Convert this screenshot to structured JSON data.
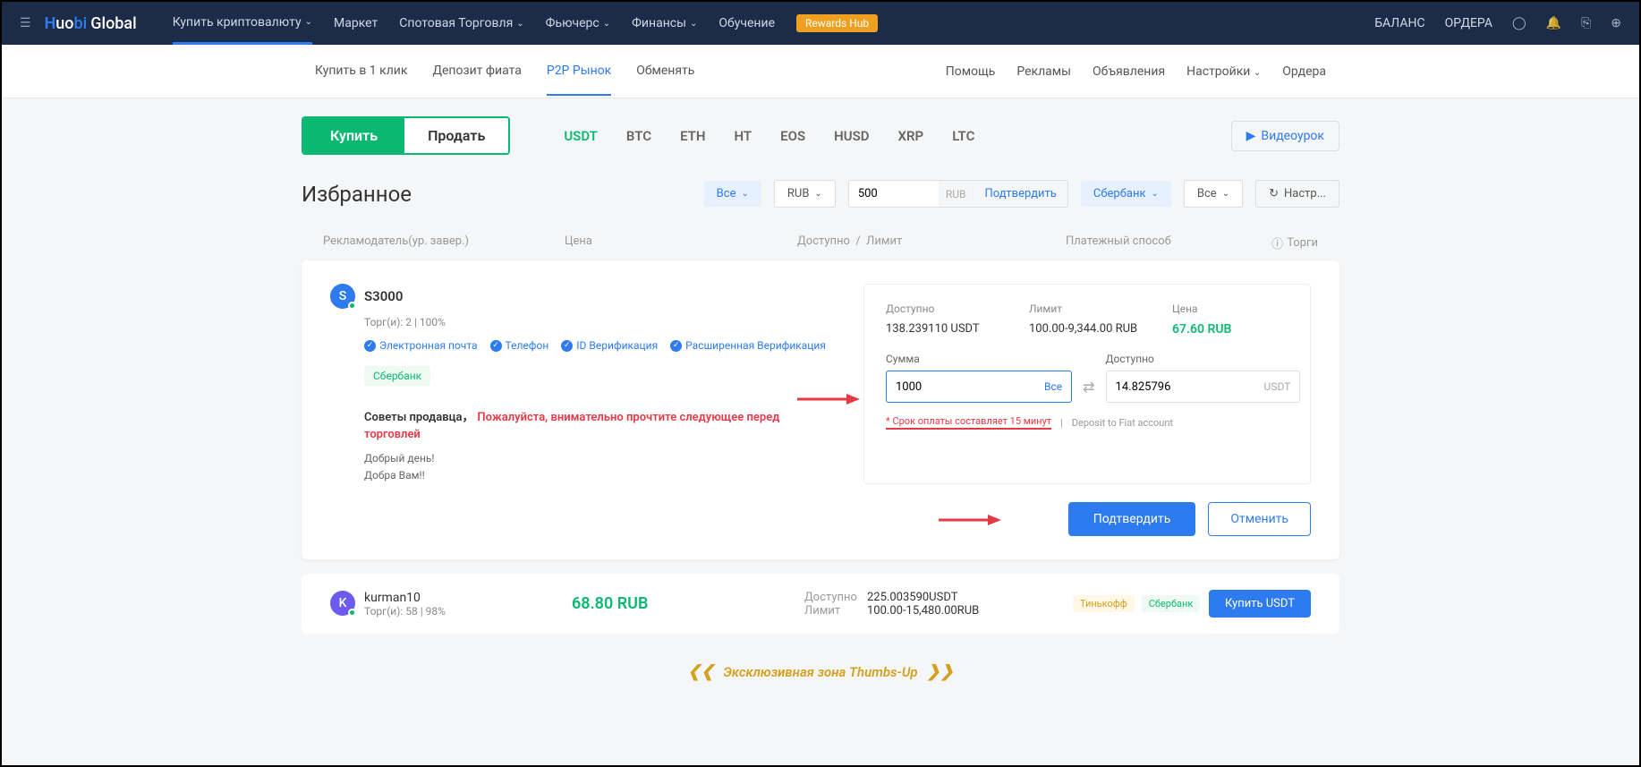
{
  "topnav": {
    "buy_crypto": "Купить криптовалюту",
    "market": "Маркет",
    "spot": "Спотовая Торговля",
    "futures": "Фьючерс",
    "finance": "Финансы",
    "learn": "Обучение",
    "rewards": "Rewards Hub",
    "balance": "БАЛАНС",
    "orders": "ОРДЕРА"
  },
  "subnav": {
    "one_click": "Купить в 1 клик",
    "fiat_deposit": "Депозит фиата",
    "p2p": "P2P Рынок",
    "exchange": "Обменять",
    "help": "Помощь",
    "ads": "Рекламы",
    "listings": "Объявления",
    "settings": "Настройки",
    "orders": "Ордера"
  },
  "trade": {
    "buy": "Купить",
    "sell": "Продать",
    "coins": [
      "USDT",
      "BTC",
      "ETH",
      "HT",
      "EOS",
      "HUSD",
      "XRP",
      "LTC"
    ],
    "video": "Видеоурок"
  },
  "filters": {
    "title": "Избранное",
    "all": "Все",
    "currency": "RUB",
    "amount": "500",
    "amount_unit": "RUB",
    "confirm": "Подтвердить",
    "bank": "Сбербанк",
    "all2": "Все",
    "settings": "Настр..."
  },
  "table": {
    "advertiser": "Рекламодатель(ур. завер.)",
    "price": "Цена",
    "available": "Доступно",
    "limit": "Лимит",
    "payment": "Платежный способ",
    "trades": "Торги"
  },
  "order1": {
    "avatar": "S",
    "name": "S3000",
    "stats": "Торг(и): 2 | 100%",
    "badges": [
      "Электронная почта",
      "Телефон",
      "ID Верификация",
      "Расширенная Верификация"
    ],
    "payment": "Сбербанк",
    "tips_label": "Советы продавца，",
    "tips_warn": "Пожалуйста, внимательно прочтите следующее перед торговлей",
    "greeting1": "Добрый день!",
    "greeting2": "Добра Вам!!",
    "panel": {
      "available_label": "Доступно",
      "available_value": "138.239110 USDT",
      "limit_label": "Лимит",
      "limit_value": "100.00-9,344.00 RUB",
      "price_label": "Цена",
      "price_value": "67.60 RUB",
      "sum_label": "Сумма",
      "sum_value": "1000",
      "sum_all": "Все",
      "avail2_label": "Доступно",
      "avail2_value": "14.825796",
      "avail2_unit": "USDT",
      "note_time": "* Срок оплаты составляет 15 минут",
      "note_deposit": "Deposit to Fiat account"
    },
    "confirm_btn": "Подтвердить",
    "cancel_btn": "Отменить"
  },
  "order2": {
    "avatar": "K",
    "name": "kurman10",
    "stats": "Торг(и): 58 | 98%",
    "price": "68.80 RUB",
    "available_label": "Доступно",
    "available_value": "225.003590USDT",
    "limit_label": "Лимит",
    "limit_value": "100.00-15,480.00RUB",
    "pay1": "Тинькофф",
    "pay2": "Сбербанк",
    "buy": "Купить USDT"
  },
  "exclusive": "Эксклюзивная зона Thumbs-Up"
}
